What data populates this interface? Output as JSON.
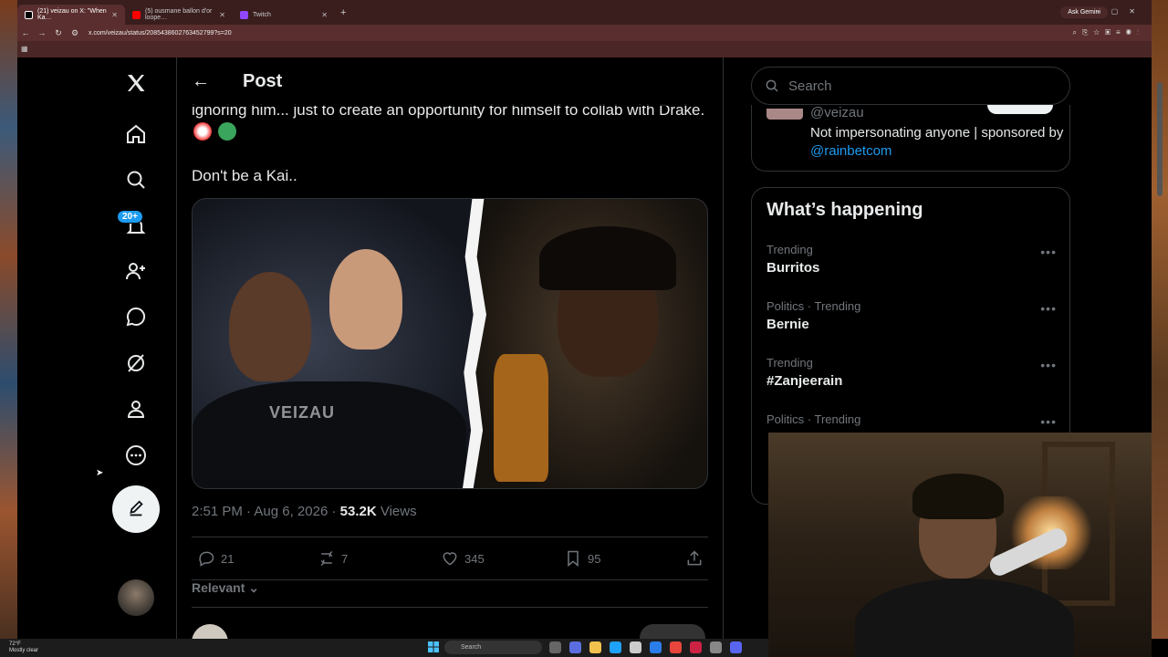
{
  "browser": {
    "tabs": [
      {
        "label": "(21) veizau on X: \"When Ka…",
        "color": "#ffffff"
      },
      {
        "label": "(5) ousmane ballon d'or loope…",
        "color": "#ff0000"
      },
      {
        "label": "Twitch",
        "color": "#9146ff"
      }
    ],
    "new_tab": "+",
    "gemini_label": "Ask Gemini",
    "url": "x.com/veizau/status/2085438602763452799?s=20"
  },
  "nav": {
    "notif_badge": "20+"
  },
  "post": {
    "header_title": "Post",
    "text_line1": "ignoring him... just to create an opportunity for himself to collab with Drake.",
    "text_line2": "Don't be a Kai..",
    "watermark": "VEIZAU",
    "time": "2:51 PM",
    "date": "Aug 6, 2026",
    "views_count": "53.2K",
    "views_label": "Views",
    "replies": "21",
    "reposts": "7",
    "likes": "345",
    "bookmarks": "95",
    "sort_label": "Relevant"
  },
  "sidebar": {
    "search_placeholder": "Search",
    "promo_handle": "@veizau",
    "promo_bio": "Not impersonating anyone | sponsored by",
    "promo_link": "@rainbetcom",
    "happening_title": "What’s happening",
    "trends": [
      {
        "context": "Trending",
        "name": "Burritos"
      },
      {
        "context": "Politics · Trending",
        "name": "Bernie"
      },
      {
        "context": "Trending",
        "name": "#Zanjeerain"
      },
      {
        "context": "Politics · Trending",
        "name": ""
      }
    ]
  },
  "taskbar": {
    "temp": "72°F",
    "weather": "Mostly clear",
    "search": "Search"
  },
  "colors": {
    "accent": "#1d9bf0",
    "text": "#e7e9ea",
    "muted": "#71767b",
    "border": "#2f3336"
  }
}
